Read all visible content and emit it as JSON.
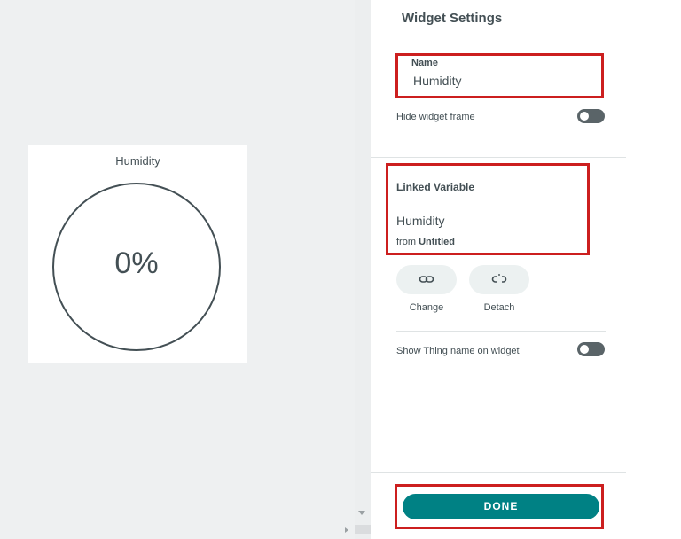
{
  "widget": {
    "title": "Humidity",
    "value_display": "0%",
    "value_percent": 0
  },
  "settings": {
    "title": "Widget Settings",
    "name_label": "Name",
    "name_value": "Humidity",
    "hide_frame_label": "Hide widget frame",
    "hide_frame_on": false,
    "linked_variable": {
      "label": "Linked Variable",
      "value": "Humidity",
      "from_prefix": "from",
      "from_thing": "Untitled",
      "change_label": "Change",
      "detach_label": "Detach"
    },
    "show_thing_label": "Show Thing name on widget",
    "show_thing_on": false,
    "done_label": "DONE"
  },
  "colors": {
    "accent": "#008184",
    "highlight": "#cc1f1f",
    "text": "#434f54",
    "canvas": "#eef0f1"
  },
  "icons": {
    "change": "link-icon",
    "detach": "unlink-icon"
  }
}
